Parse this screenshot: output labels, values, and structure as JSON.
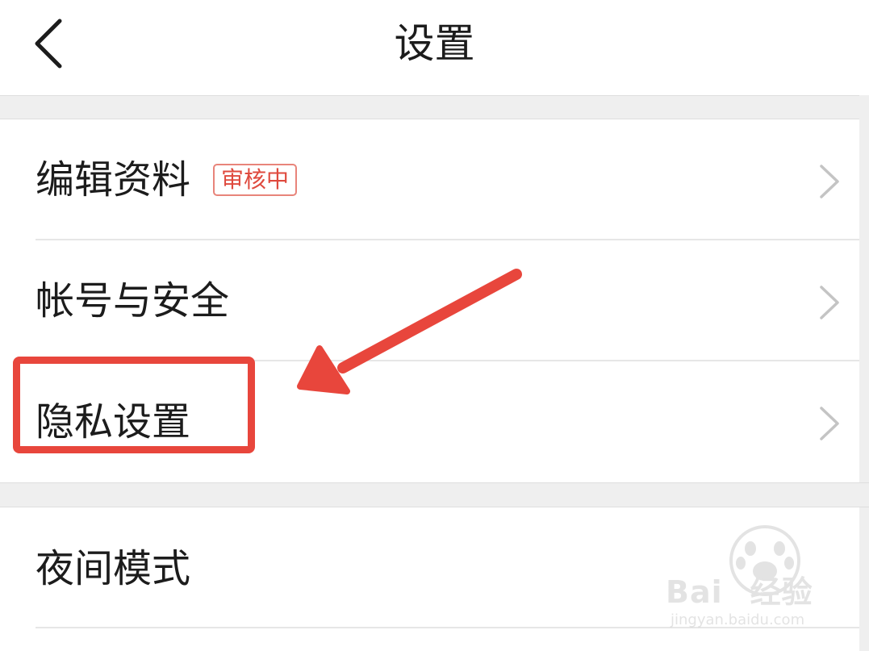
{
  "header": {
    "title": "设置",
    "back_icon": "chevron-left-icon"
  },
  "settings": {
    "group1": [
      {
        "label": "编辑资料",
        "badge": "审核中"
      },
      {
        "label": "帐号与安全"
      },
      {
        "label": "隐私设置"
      }
    ],
    "group2": [
      {
        "label": "夜间模式"
      }
    ]
  },
  "annotation": {
    "color": "#e8463c",
    "highlight_target": "隐私设置",
    "arrow_icon": "arrow-icon"
  },
  "watermark": {
    "brand_left": "Bai",
    "brand_right": "经验",
    "url": "jingyan.baidu.com"
  },
  "colors": {
    "badge_text": "#df4a3e",
    "badge_border": "#e8847a",
    "background_band": "#efefef",
    "chevron": "#c4c4c4"
  }
}
